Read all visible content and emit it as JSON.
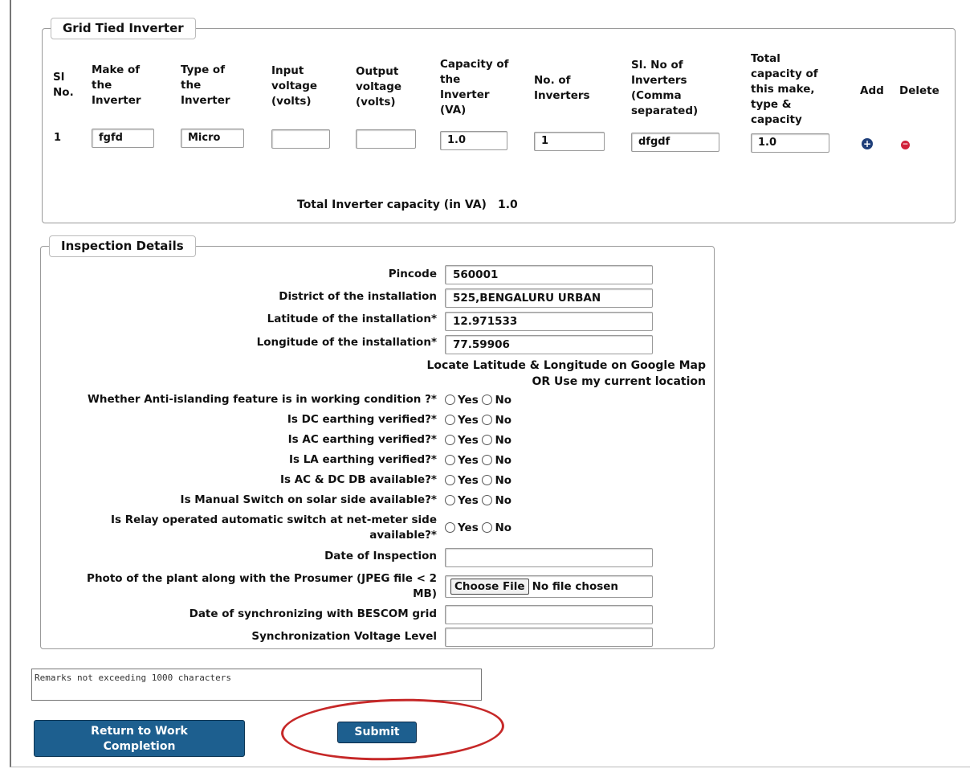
{
  "inverter": {
    "legend": "Grid Tied Inverter",
    "headers": {
      "sl_no": [
        "Sl",
        "No."
      ],
      "make": [
        "Make of",
        "the",
        "Inverter"
      ],
      "type": [
        "Type of",
        "the",
        "Inverter"
      ],
      "input_voltage": [
        "Input",
        "voltage",
        "(volts)"
      ],
      "output_voltage": [
        "Output",
        "voltage",
        "(volts)"
      ],
      "capacity": [
        "Capacity of",
        "the",
        "Inverter",
        "(VA)"
      ],
      "no_inverters": [
        "No. of",
        "Inverters"
      ],
      "serial_nos": [
        "Sl. No of",
        "Inverters",
        "(Comma",
        "separated)"
      ],
      "total_capacity": [
        "Total",
        "capacity of",
        "this make,",
        "type &",
        "capacity"
      ],
      "add": "Add",
      "delete": "Delete"
    },
    "row": {
      "sl_no": "1",
      "make": "fgfd",
      "type": "Micro",
      "input_voltage": "",
      "output_voltage": "",
      "capacity": "1.0",
      "no_inverters": "1",
      "serial_nos": "dfgdf",
      "total_capacity": "1.0"
    },
    "total_label": "Total Inverter capacity (in VA)",
    "total_value": "1.0"
  },
  "inspection": {
    "legend": "Inspection Details",
    "pincode": {
      "label": "Pincode",
      "value": "560001"
    },
    "district": {
      "label": "District of the installation",
      "value": "525,BENGALURU URBAN"
    },
    "latitude": {
      "label": "Latitude of the installation*",
      "value": "12.971533"
    },
    "longitude": {
      "label": "Longitude of the installation*",
      "value": "77.59906"
    },
    "locate_link": "Locate Latitude & Longitude on Google Map",
    "current_location_link": "OR Use my current location",
    "yes_label": "Yes",
    "no_label": "No",
    "questions": [
      "Whether Anti-islanding feature is in working condition ?*",
      "Is DC earthing verified?*",
      "Is AC earthing verified?*",
      "Is LA earthing verified?*",
      "Is AC & DC DB available?*",
      "Is Manual Switch on solar side available?*"
    ],
    "relay_question_line1": "Is Relay operated automatic switch at net-meter side",
    "relay_question_line2": "available?*",
    "date_of_inspection": {
      "label": "Date of Inspection",
      "value": ""
    },
    "photo": {
      "label_line1": "Photo of the plant along with the Prosumer (JPEG file < 2",
      "label_line2": "MB)",
      "button": "Choose File",
      "status": "No file chosen"
    },
    "sync_date": {
      "label": "Date of synchronizing with BESCOM grid",
      "value": ""
    },
    "sync_voltage": {
      "label": "Synchronization Voltage Level",
      "value": ""
    }
  },
  "remarks": {
    "placeholder": "Remarks not exceeding 1000 characters"
  },
  "buttons": {
    "return_line1": "Return to Work",
    "return_line2": "Completion",
    "submit": "Submit"
  },
  "colors": {
    "button_blue": "#1d5f8f",
    "add_icon": "#1f3f7a",
    "delete_icon": "#d0223a",
    "annotation_red": "#c62828"
  }
}
